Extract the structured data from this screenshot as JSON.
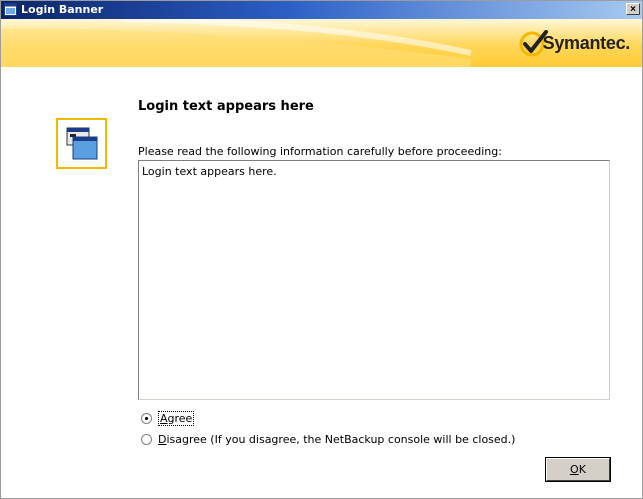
{
  "window": {
    "title": "Login Banner",
    "close_label": "×"
  },
  "banner": {
    "logo_text": "Symantec.",
    "colors": {
      "accent": "#ffcc33",
      "check": "#f5b800"
    }
  },
  "content": {
    "heading": "Login text appears here",
    "instruction": "Please read the following information carefully before proceeding:",
    "login_text": "Login text appears here."
  },
  "options": {
    "agree": {
      "mnemonic": "A",
      "rest": "gree",
      "checked": true
    },
    "disagree": {
      "mnemonic": "D",
      "rest": "isagree (If you disagree, the NetBackup console will be closed.)",
      "checked": false
    }
  },
  "buttons": {
    "ok": {
      "mnemonic": "O",
      "rest": "K"
    }
  },
  "icons": {
    "title": "window-app-icon",
    "main": "console-window-icon",
    "logo": "checkmark-icon"
  }
}
